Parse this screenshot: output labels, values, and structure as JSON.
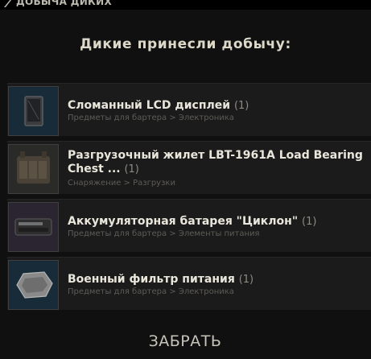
{
  "window": {
    "title": "ДОБЫЧА ДИКИХ",
    "icon": "knife-icon"
  },
  "main": {
    "heading": "Дикие принесли добычу:",
    "items": [
      {
        "name": "Сломанный LCD дисплей",
        "name_line2": "",
        "qty": "(1)",
        "category": "Предметы для бартера > Электроника",
        "icon": "lcd-screen-icon"
      },
      {
        "name": "Разгрузочный жилет LBT-1961A Load Bearing",
        "name_line2": "Chest ...",
        "qty": "(1)",
        "category": "Снаряжение > Разгрузки",
        "icon": "tactical-vest-icon"
      },
      {
        "name": "Аккумуляторная батарея \"Циклон\"",
        "name_line2": "",
        "qty": "(1)",
        "category": "Предметы для бартера > Элементы питания",
        "icon": "battery-icon"
      },
      {
        "name": "Военный фильтр питания",
        "name_line2": "",
        "qty": "(1)",
        "category": "Предметы для бартера > Электроника",
        "icon": "power-filter-icon"
      }
    ]
  },
  "footer": {
    "take_label": "ЗАБРАТЬ"
  }
}
